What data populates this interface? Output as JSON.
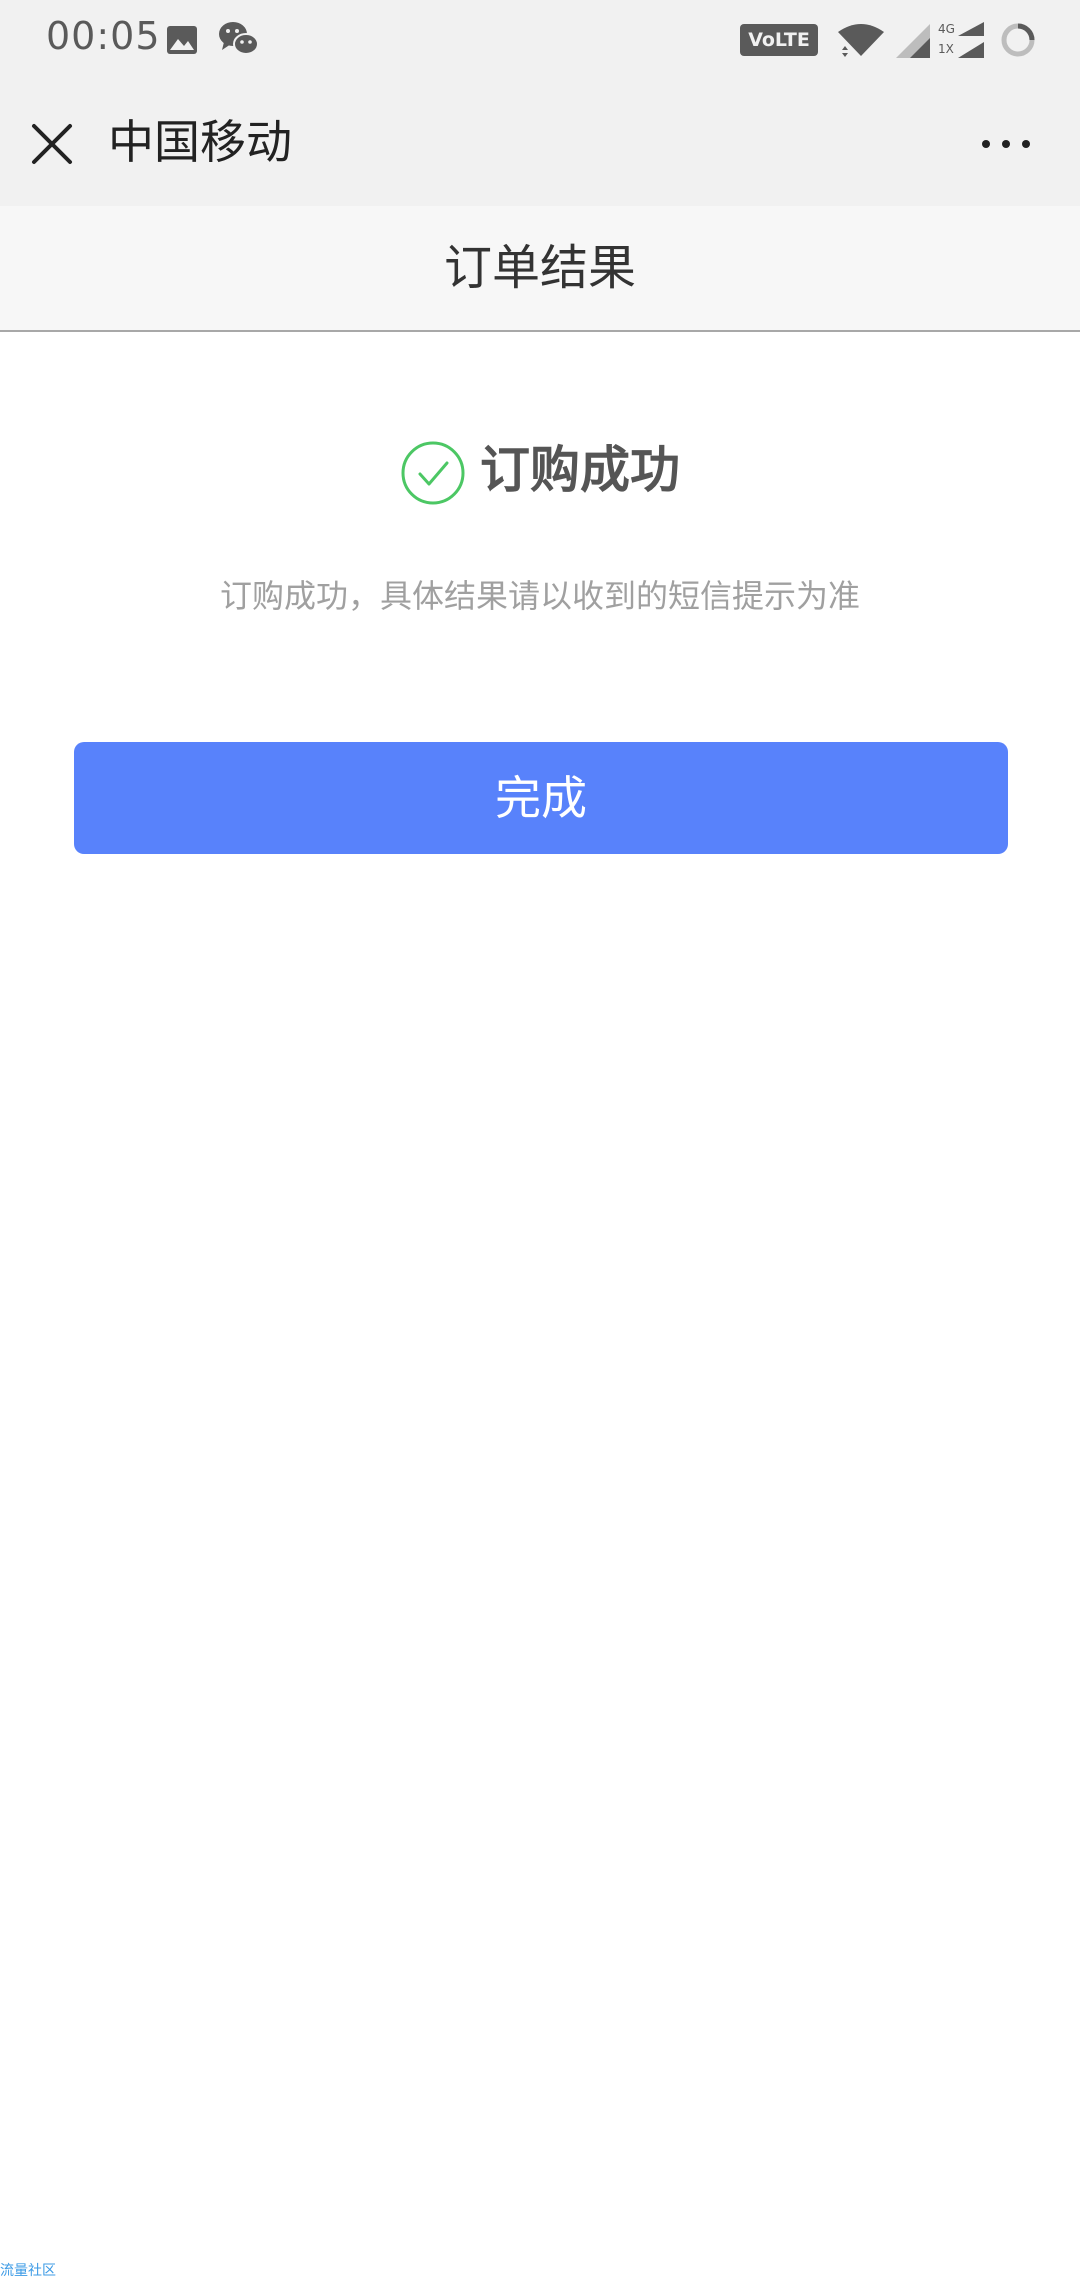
{
  "status_bar": {
    "time": "00:05",
    "volte": "VoLTE 1",
    "net_top": "4G",
    "net_bottom": "1X",
    "icons": [
      "image-icon",
      "wechat-icon",
      "volte-icon",
      "wifi-icon",
      "signal-icon",
      "network-signal-icon",
      "loading-icon"
    ]
  },
  "header": {
    "title": "中国移动",
    "close_icon": "close-icon",
    "more_icon": "more-icon"
  },
  "page": {
    "title": "订单结果"
  },
  "result": {
    "title": "订购成功",
    "description": "订购成功，具体结果请以收到的短信提示为准",
    "status_icon": "check-circle-icon"
  },
  "actions": {
    "done_label": "完成"
  },
  "footer": {
    "watermark": "流量社区"
  },
  "colors": {
    "accent": "#5882fb",
    "success": "#4cc764",
    "header_bg": "#f1f1f1"
  }
}
